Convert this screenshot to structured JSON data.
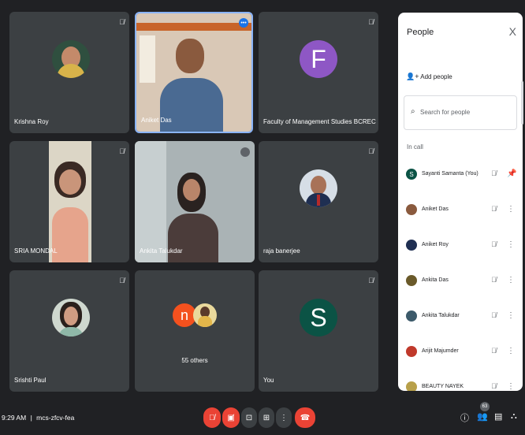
{
  "tiles": [
    {
      "name": "Krishna Roy"
    },
    {
      "name": "Aniket Das"
    },
    {
      "name": "Faculty of Management Studies BCREC",
      "letter": "F",
      "color": "#8e57c5"
    },
    {
      "name": "SRIA MONDAL"
    },
    {
      "name": "Ankita Talukdar"
    },
    {
      "name": "raja banerjee"
    },
    {
      "name": "Srishti Paul"
    },
    {
      "name": "55 others",
      "initial": "n",
      "color": "#f4511e"
    },
    {
      "name": "You",
      "letter": "S",
      "color": "#0b5345"
    }
  ],
  "panel": {
    "title": "People",
    "close": "X",
    "add_label": "Add people",
    "search_placeholder": "Search for people",
    "in_call_label": "In call",
    "participants": [
      {
        "name": "Sayanti Samanta (You)",
        "initial": "S",
        "color": "#0b5345"
      },
      {
        "name": "Aniket Das"
      },
      {
        "name": "Aniket Roy"
      },
      {
        "name": "Ankita Das"
      },
      {
        "name": "Ankita Talukdar"
      },
      {
        "name": "Arijit Majumder"
      },
      {
        "name": "BEAUTY NAYEK"
      }
    ]
  },
  "bottom": {
    "time": "9:29 AM",
    "separator": "|",
    "meeting_code": "mcs-zfcv-fea",
    "people_count": "63"
  }
}
